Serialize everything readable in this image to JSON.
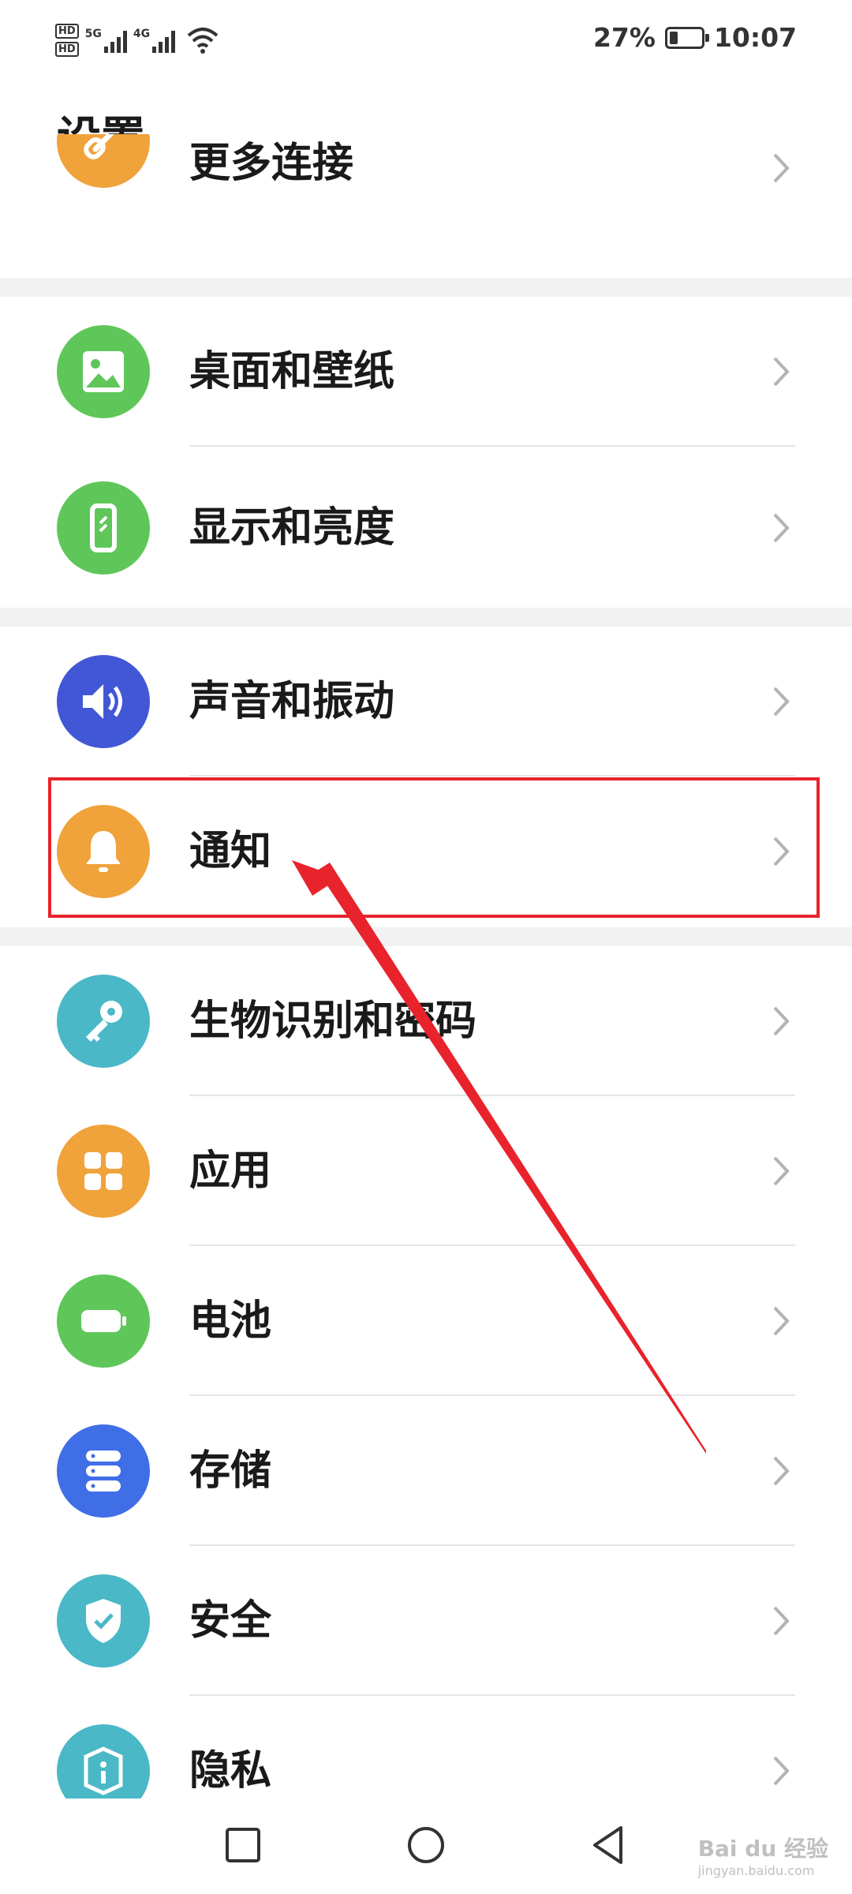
{
  "status": {
    "hd1": "HD",
    "hd2": "HD",
    "net1": "5G",
    "net2": "4G",
    "battery_percent": "27%",
    "battery_level": 0.27,
    "time": "10:07"
  },
  "page_title": "设置",
  "items": [
    {
      "label": "更多连接",
      "icon": "link-icon",
      "color": "#f0a23b"
    },
    {
      "label": "桌面和壁纸",
      "icon": "image-icon",
      "color": "#5fc65a"
    },
    {
      "label": "显示和亮度",
      "icon": "phone-display-icon",
      "color": "#5fc65a"
    },
    {
      "label": "声音和振动",
      "icon": "speaker-icon",
      "color": "#4257d6"
    },
    {
      "label": "通知",
      "icon": "bell-icon",
      "color": "#f0a23b"
    },
    {
      "label": "生物识别和密码",
      "icon": "key-icon",
      "color": "#4ab8c6"
    },
    {
      "label": "应用",
      "icon": "apps-grid-icon",
      "color": "#f0a23b"
    },
    {
      "label": "电池",
      "icon": "battery-icon",
      "color": "#5fc65a"
    },
    {
      "label": "存储",
      "icon": "storage-icon",
      "color": "#3f6ee6"
    },
    {
      "label": "安全",
      "icon": "shield-icon",
      "color": "#4ab8c6"
    },
    {
      "label": "隐私",
      "icon": "privacy-lock-icon",
      "color": "#4ab8c6"
    }
  ],
  "watermark": {
    "brand": "Bai du 经验",
    "url": "jingyan.baidu.com"
  },
  "colors": {
    "highlight": "#e8232b",
    "divider": "#e5e5e5",
    "band": "#f2f2f2"
  }
}
